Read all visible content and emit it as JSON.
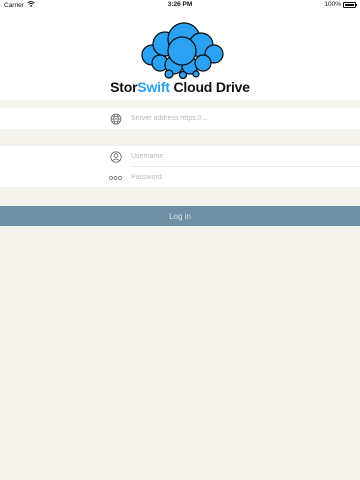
{
  "status_bar": {
    "carrier": "Carrier",
    "time": "3:26 PM",
    "battery": "100%",
    "battery_level": 1.0
  },
  "brand": {
    "name_part1": "Stor",
    "name_part2": "Swift",
    "name_part3": " Cloud Drive",
    "accent_color": "#2a9ff0"
  },
  "form": {
    "server_placeholder": "Server address https://...",
    "username_placeholder": "Username",
    "password_placeholder": "Password",
    "login_label": "Log in"
  },
  "icons": {
    "server": "globe-icon",
    "username": "user-icon",
    "password": "password-dots-icon",
    "wifi": "wifi-icon",
    "battery": "battery-icon",
    "logo": "cloud-logo-icon"
  },
  "colors": {
    "login_button": "#6f8ea3",
    "background": "#f4f3ee"
  }
}
